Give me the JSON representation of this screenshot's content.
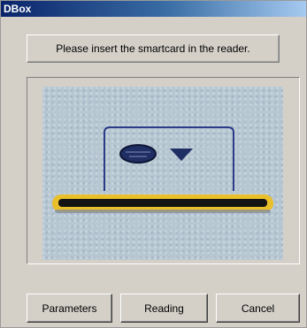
{
  "window": {
    "title": "DBox"
  },
  "message": {
    "text": "Please insert the smartcard in the reader."
  },
  "illustration": {
    "icon": "smartcard-reader-illustration"
  },
  "buttons": {
    "parameters": "Parameters",
    "reading": "Reading",
    "cancel": "Cancel"
  }
}
